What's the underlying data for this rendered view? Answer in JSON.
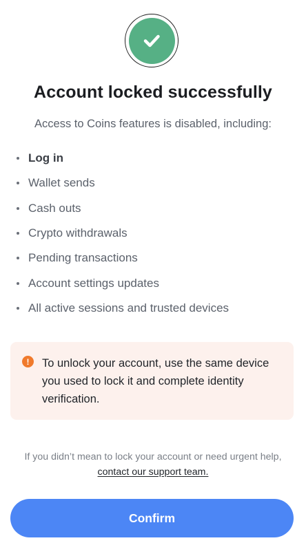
{
  "header": {
    "icon": "checkmark-icon",
    "title": "Account locked successfully",
    "subtitle": "Access to Coins features is disabled, including:"
  },
  "features": [
    {
      "label": "Log in",
      "emphasis": true
    },
    {
      "label": "Wallet sends",
      "emphasis": false
    },
    {
      "label": "Cash outs",
      "emphasis": false
    },
    {
      "label": "Crypto withdrawals",
      "emphasis": false
    },
    {
      "label": "Pending transactions",
      "emphasis": false
    },
    {
      "label": "Account settings updates",
      "emphasis": false
    },
    {
      "label": "All active sessions and trusted devices",
      "emphasis": false
    }
  ],
  "notice": {
    "icon": "warning-icon",
    "icon_glyph": "!",
    "text": "To unlock your account, use the same device you used to lock it and complete identity verification."
  },
  "help": {
    "text": "If you didn’t mean to lock your account or need urgent help, ",
    "link_label": "contact our support team."
  },
  "actions": {
    "confirm_label": "Confirm"
  },
  "colors": {
    "success": "#56b085",
    "primary": "#4c86f5",
    "warning": "#f07a2c",
    "notice_bg": "#fdf1ed"
  }
}
